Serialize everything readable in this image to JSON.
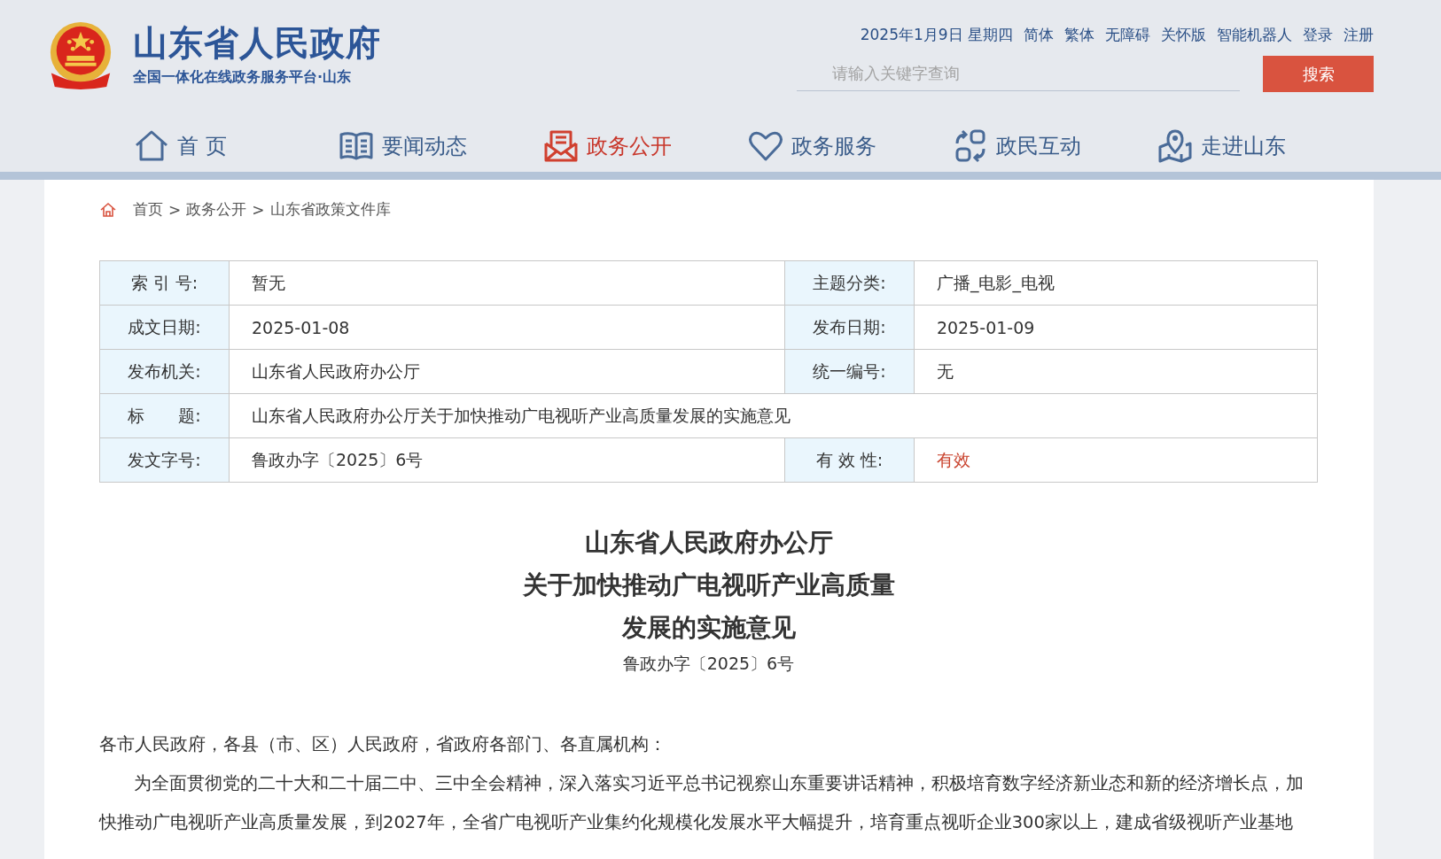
{
  "header": {
    "site_title": "山东省人民政府",
    "site_subtitle": "全国一体化在线政务服务平台·山东",
    "date": "2025年1月9日 星期四",
    "top_links": [
      "简体",
      "繁体",
      "无障碍",
      "关怀版",
      "智能机器人",
      "登录",
      "注册"
    ],
    "search": {
      "placeholder": "请输入关键字查询",
      "button": "搜索"
    }
  },
  "nav": [
    {
      "label": "首 页",
      "selected": false
    },
    {
      "label": "要闻动态",
      "selected": false
    },
    {
      "label": "政务公开",
      "selected": true
    },
    {
      "label": "政务服务",
      "selected": false
    },
    {
      "label": "政民互动",
      "selected": false
    },
    {
      "label": "走进山东",
      "selected": false
    }
  ],
  "breadcrumb": [
    {
      "label": "首页",
      "separator": ">"
    },
    {
      "label": "政务公开",
      "separator": ">"
    },
    {
      "label": "山东省政策文件库"
    }
  ],
  "table": {
    "rows": [
      [
        {
          "label": "索 引 号:",
          "value": "暂无",
          "kind": "text"
        },
        {
          "label": "主题分类:",
          "value": "广播_电影_电视",
          "kind": "text"
        }
      ],
      [
        {
          "label": "成文日期:",
          "value": "2025-01-08",
          "kind": "text"
        },
        {
          "label": "发布日期:",
          "value": "2025-01-09",
          "kind": "text"
        }
      ],
      [
        {
          "label": "发布机关:",
          "value": "山东省人民政府办公厅",
          "kind": "text"
        },
        {
          "label": "统一编号:",
          "value": "无",
          "kind": "text"
        }
      ],
      [
        {
          "label": "标　　题:",
          "value": "山东省人民政府办公厅关于加快推动广电视听产业高质量发展的实施意见",
          "kind": "text"
        }
      ],
      [
        {
          "label": "发文字号:",
          "value": "鲁政办字〔2025〕6号",
          "kind": "text"
        },
        {
          "label": "有 效 性:",
          "value": "有效",
          "kind": "status"
        }
      ]
    ]
  },
  "document": {
    "title_lines": [
      "山东省人民政府办公厅",
      "关于加快推动广电视听产业高质量",
      "发展的实施意见"
    ],
    "doc_number": "鲁政办字〔2025〕6号",
    "salutation": "各市人民政府，各县（市、区）人民政府，省政府各部门、各直属机构：",
    "paragraphs": [
      "为全面贯彻党的二十大和二十届二中、三中全会精神，深入落实习近平总书记视察山东重要讲话精神，积极培育数字经济新业态和新的经济增长点，加快推动广电视听产业高质量发展，到2027年，全省广电视听产业集约化规模化发展水平大幅提升，培育重点视听企业300家以上，建成省级视听产业基地"
    ]
  }
}
